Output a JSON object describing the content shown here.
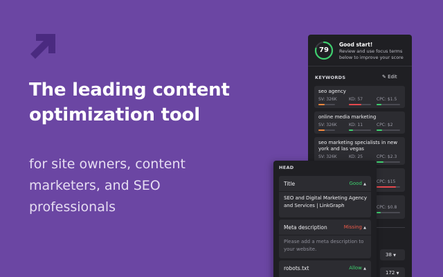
{
  "hero": {
    "headline": "The leading content optimization tool",
    "subline": "for site owners, content marketers, and SEO professionals"
  },
  "colors": {
    "background": "#6b46a3",
    "panel": "#1f1f23",
    "good": "#3ecf6e",
    "missing": "#ef5b4a",
    "bar_orange": "#f0883e",
    "bar_red": "#e5484d",
    "bar_green": "#3ecf6e"
  },
  "score_card": {
    "score": "79",
    "title": "Good start!",
    "description": "Review and use focus terms below to improve your score",
    "progress_fraction": 0.79
  },
  "keywords": {
    "header": "KEYWORDS",
    "edit_label": "Edit",
    "items": [
      {
        "name": "seo agency",
        "sv": "SV: 326K",
        "kd": "KD: 57",
        "cpc": "CPC: $1.5"
      },
      {
        "name": "online media marketing",
        "sv": "SV: 326K",
        "kd": "KD: 11",
        "cpc": "CPC: $2"
      },
      {
        "name": "seo marketing specialists in new york and las vegas",
        "sv": "SV: 326K",
        "kd": "KD: 25",
        "cpc": "CPC: $2.3"
      }
    ],
    "partial_cpc": [
      "CPC: $15",
      "CPC: $0.8"
    ],
    "counts": [
      "38",
      "172"
    ]
  },
  "head_panel": {
    "label": "HEAD",
    "title_card": {
      "label": "Title",
      "status": "Good",
      "value": "SEO and Digital Marketing Agency and Services | LinkGraph"
    },
    "meta_card": {
      "label": "Meta description",
      "status": "Missing",
      "value": "Please add a meta description to your website."
    },
    "robots_card": {
      "label": "robots.txt",
      "status": "Allow"
    }
  }
}
